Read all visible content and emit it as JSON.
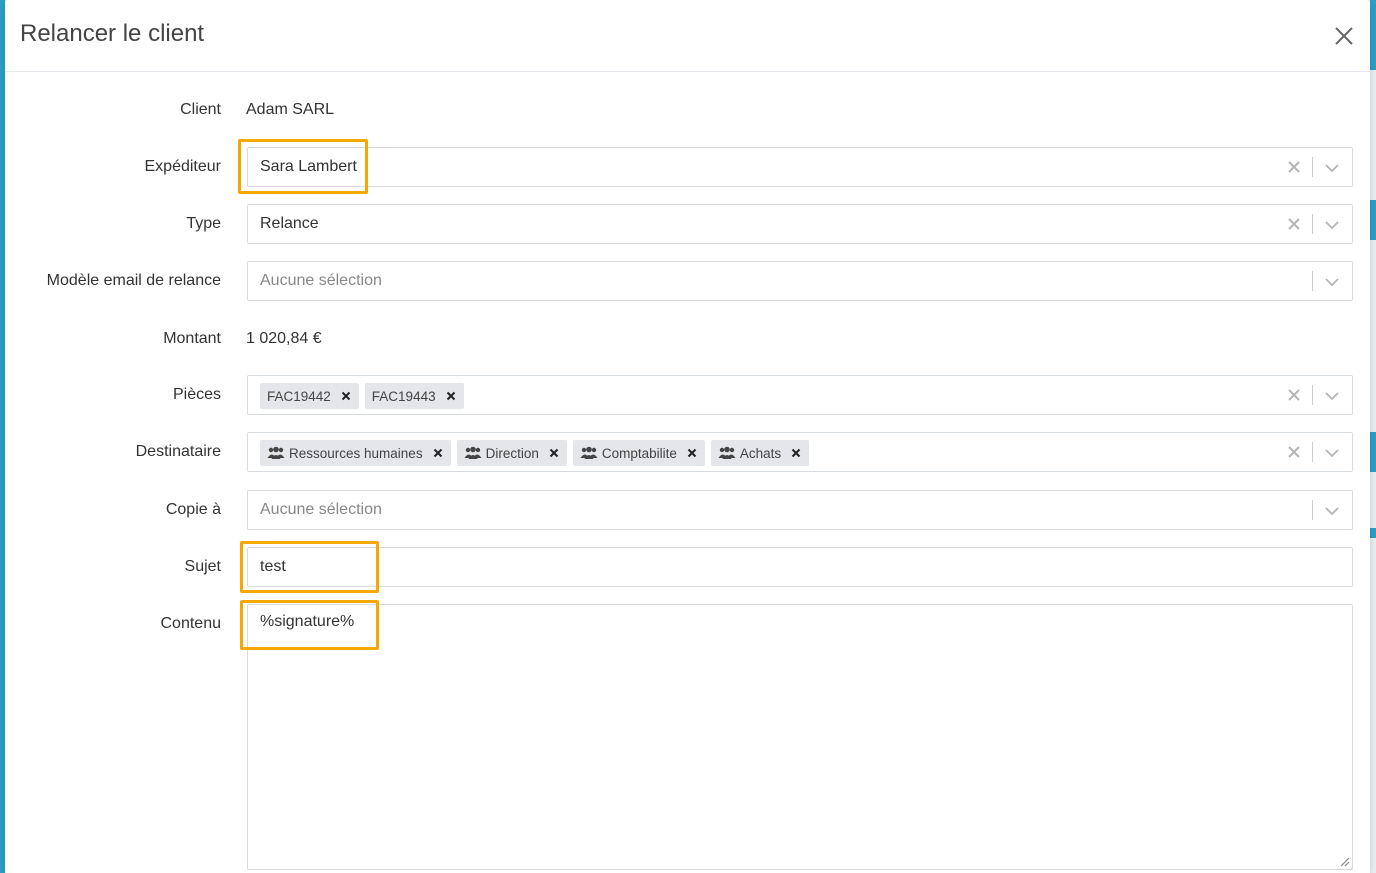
{
  "modal": {
    "title": "Relancer le client"
  },
  "fields": {
    "client": {
      "label": "Client",
      "value": "Adam SARL"
    },
    "expediteur": {
      "label": "Expéditeur",
      "value": "Sara Lambert"
    },
    "type": {
      "label": "Type",
      "value": "Relance"
    },
    "modele": {
      "label": "Modèle email de relance",
      "placeholder": "Aucune sélection"
    },
    "montant": {
      "label": "Montant",
      "value": "1 020,84 €"
    },
    "pieces": {
      "label": "Pièces",
      "tags": [
        "FAC19442",
        "FAC19443"
      ]
    },
    "destinataire": {
      "label": "Destinataire",
      "tags": [
        "Ressources humaines",
        "Direction",
        "Comptabilite",
        "Achats"
      ]
    },
    "copie": {
      "label": "Copie à",
      "placeholder": "Aucune sélection"
    },
    "sujet": {
      "label": "Sujet",
      "value": "test"
    },
    "contenu": {
      "label": "Contenu",
      "value": "%signature%"
    }
  },
  "colors": {
    "highlight": "#f5a800",
    "accent": "#2aa3c9"
  },
  "icons": {
    "close": "close-icon",
    "clear": "clear-icon",
    "chevron": "chevron-down-icon",
    "group": "users-icon"
  }
}
